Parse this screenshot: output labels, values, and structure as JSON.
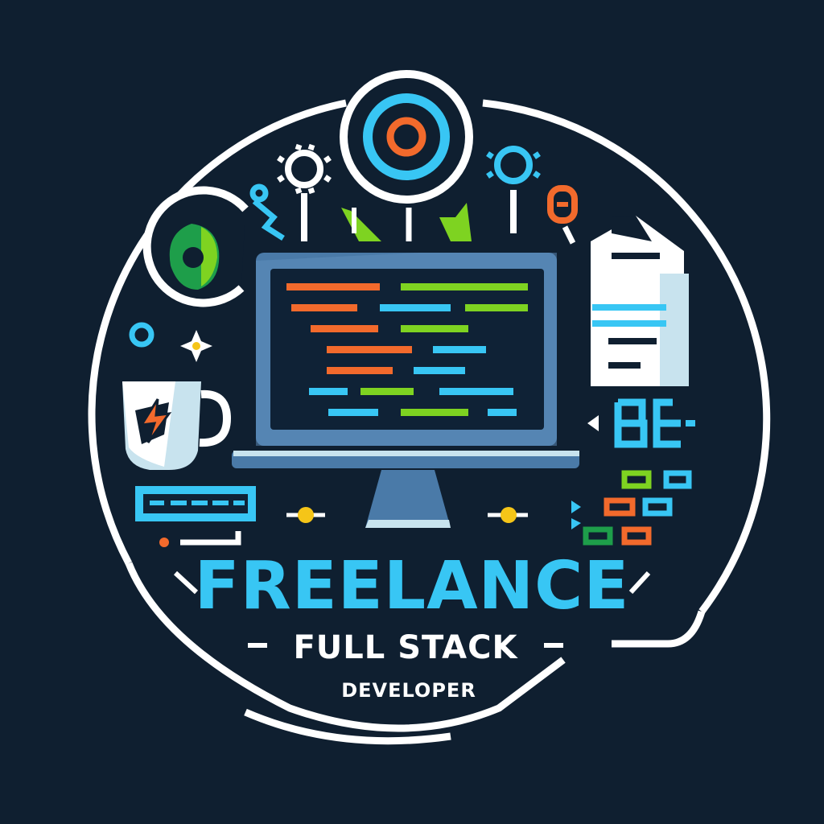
{
  "logo": {
    "title": "FREELANCE",
    "subtitle": "FULL STACK",
    "tagline": "DEVELOPER"
  },
  "colors": {
    "background": "#0f1f30",
    "outline": "#ffffff",
    "cyan": "#38c6f4",
    "orange": "#f26a2c",
    "green": "#7ed321",
    "dark_green": "#1e9e4a",
    "monitor_frame": "#4a7aa8",
    "monitor_screen": "#0f2236",
    "yellow": "#f5c518",
    "paper": "#c8e3ee"
  },
  "icons": [
    "target-icon",
    "gear-icon",
    "monitor-icon",
    "code-lines-icon",
    "coffee-mug-icon",
    "lightning-icon",
    "document-icon",
    "sparkle-icon",
    "keyboard-icon",
    "circuit-node-icon",
    "green-shield-icon"
  ]
}
